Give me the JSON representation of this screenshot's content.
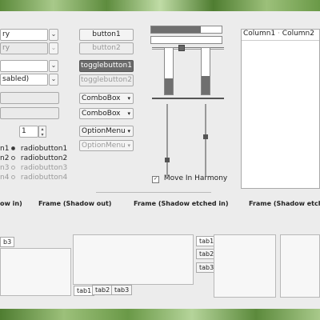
{
  "left": {
    "entries": [
      {
        "text": "ry",
        "disabled": false
      },
      {
        "text": "ry",
        "disabled": true
      },
      {
        "text": "",
        "disabled": true
      },
      {
        "text": "sabled)",
        "disabled": false
      }
    ],
    "spin_value": "1",
    "radio_left_labels": [
      "n1",
      "n2",
      "n3",
      "n4"
    ],
    "radios": [
      {
        "label": "radiobutton1",
        "checked": true,
        "disabled": false
      },
      {
        "label": "radiobutton2",
        "checked": false,
        "disabled": false
      },
      {
        "label": "radiobutton3",
        "checked": false,
        "disabled": true
      },
      {
        "label": "radiobutton4",
        "checked": false,
        "disabled": true
      }
    ]
  },
  "middle": {
    "button1": "button1",
    "button2": "button2",
    "togglebutton1": "togglebutton1",
    "togglebutton2": "togglebutton2",
    "combo1": "ComboBox",
    "combo2": "ComboBox",
    "optionmenu1": "OptionMenu",
    "optionmenu2": "OptionMenu"
  },
  "right": {
    "columns": [
      "Column1",
      "Column2"
    ],
    "move_in_harmony": "Move In Harmony",
    "move_in_harmony_checked": true
  },
  "frames": {
    "f1": "ow in)",
    "f2": "Frame (Shadow out)",
    "f3": "Frame (Shadow etched in)",
    "f4": "Frame (Shadow etch"
  },
  "notebooks": {
    "nb1_tab": "b3",
    "nb2_tabs": [
      "tab1",
      "tab2",
      "tab3"
    ],
    "nb3_tabs": [
      "tab1",
      "tab2",
      "tab3"
    ]
  },
  "progress": {
    "h1": 0.7,
    "h2": 0.0,
    "v1": 0.35,
    "v2": 0.4
  },
  "sliders": {
    "h_value": 0.4,
    "v1_value": 0.8,
    "v2_value": 0.45
  }
}
